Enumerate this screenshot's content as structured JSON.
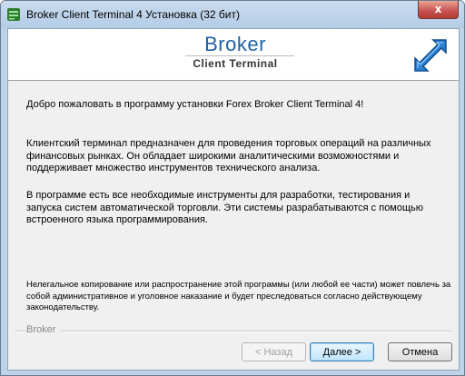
{
  "window": {
    "title": "Broker Client Terminal 4 Установка (32 бит)",
    "close_label": "x"
  },
  "header": {
    "brand_name": "Broker",
    "brand_subtitle": "Client Terminal",
    "accent_color": "#1e63a8"
  },
  "content": {
    "welcome": "Добро пожаловать в программу установки Forex Broker Client Terminal 4!",
    "para1": "Клиентский терминал предназначен для проведения торговых операций на различных финансовых рынках. Он обладает широкими аналитическими возможностями и поддерживает множество инструментов технического анализа.",
    "para2": "В программе есть все необходимые инструменты для разработки, тестирования и запуска систем автоматической торговли. Эти системы разрабатываются с помощью встроенного языка программирования.",
    "legal": "Нелегальное копирование или распространение этой программы (или любой ее части) может повлечь за собой административное и уголовное наказание и будет преследоваться согласно действующему законодательству."
  },
  "footer": {
    "group_label": "Broker",
    "back_label": "< Назад",
    "next_label": "Далее >",
    "cancel_label": "Отмена"
  }
}
